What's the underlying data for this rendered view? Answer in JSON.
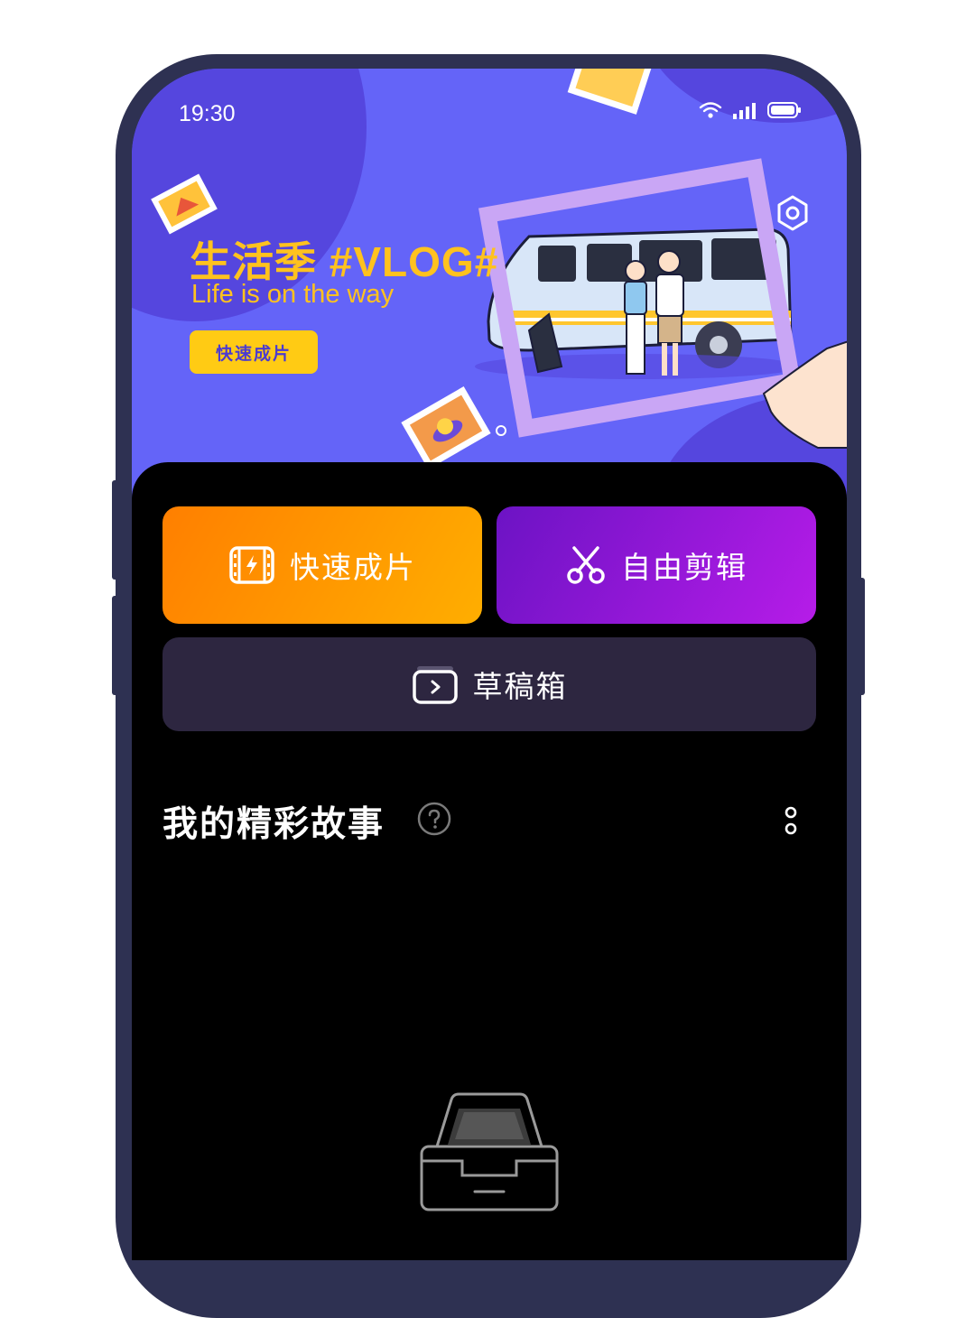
{
  "status_bar": {
    "time": "19:30",
    "icons": [
      "wifi-icon",
      "signal-icon",
      "battery-icon"
    ]
  },
  "banner": {
    "title": "生活季 #VLOG#",
    "subtitle": "Life is on the way",
    "button_label": "快速成片",
    "colors": {
      "background": "#6464f8",
      "accent": "#ffc21e"
    }
  },
  "actions": {
    "quick_label": "快速成片",
    "free_label": "自由剪辑",
    "draft_label": "草稿箱"
  },
  "section": {
    "title": "我的精彩故事"
  }
}
